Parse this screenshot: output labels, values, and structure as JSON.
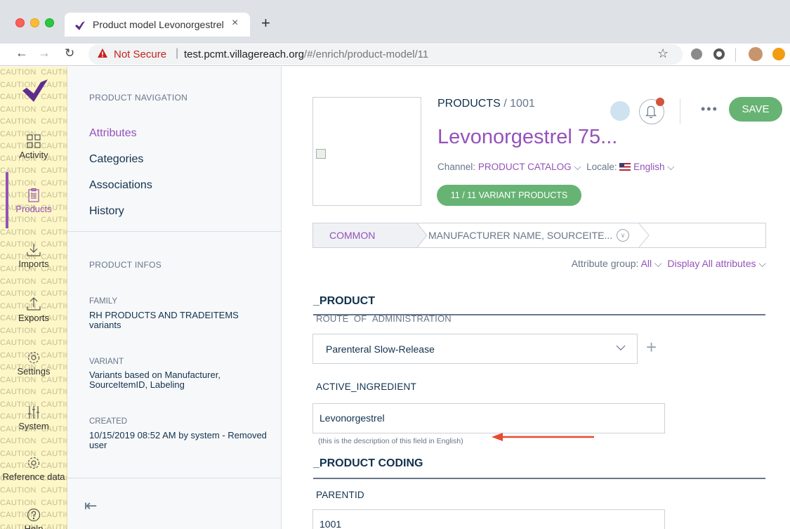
{
  "browser": {
    "tab_title": "Product model Levonorgestrel",
    "tab_close": "×",
    "new_tab": "+",
    "not_secure": "Not Secure",
    "url_host": "test.pcmt.villagereach.org",
    "url_path": "/#/enrich/product-model/11"
  },
  "rail": {
    "caution_text": "CAUTION  CAUTION",
    "items": [
      {
        "label": "Activity",
        "icon": "grid-icon"
      },
      {
        "label": "Products",
        "icon": "clipboard-icon"
      },
      {
        "label": "Imports",
        "icon": "import-icon"
      },
      {
        "label": "Exports",
        "icon": "export-icon"
      },
      {
        "label": "Settings",
        "icon": "gear-icon"
      },
      {
        "label": "System",
        "icon": "sliders-icon"
      },
      {
        "label": "Reference data",
        "icon": "gear-icon"
      },
      {
        "label": "Help",
        "icon": "help-icon"
      }
    ],
    "active_index": 1,
    "accent": "#9452ba"
  },
  "pnav": {
    "heading": "PRODUCT NAVIGATION",
    "links": [
      "Attributes",
      "Categories",
      "Associations",
      "History"
    ],
    "infos_heading": "PRODUCT INFOS",
    "family_label": "FAMILY",
    "family_value": "RH PRODUCTS AND TRADEITEMS variants",
    "variant_label": "VARIANT",
    "variant_value": "Variants based on Manufacturer, SourceItemID, Labeling",
    "created_label": "CREATED",
    "created_value": "10/15/2019 08:52 AM by system - Removed user"
  },
  "header": {
    "breadcrumb_section": "PRODUCTS",
    "breadcrumb_sep": "/",
    "breadcrumb_id": "1001",
    "title": "Levonorgestrel 75...",
    "channel_label": "Channel:",
    "channel_value": "PRODUCT CATALOG",
    "locale_label": "Locale:",
    "locale_value": "English",
    "variant_pill": "11 / 11 VARIANT PRODUCTS",
    "more": "•••",
    "save": "SAVE"
  },
  "steps": {
    "step1": "COMMON",
    "step2": "MANUFACTURER NAME, SOURCEITE..."
  },
  "filters": {
    "group_label": "Attribute group:",
    "group_value": "All",
    "display_value": "Display All attributes"
  },
  "form": {
    "group1_title": "_PRODUCT",
    "route_label": "ROUTE_OF_ADMINISTRATION",
    "route_value": "Parenteral Slow-Release",
    "plus": "+",
    "ingredient_label": "ACTIVE_INGREDIENT",
    "ingredient_value": "Levonorgestrel",
    "ingredient_desc": "(this is the description of this field in English)",
    "group2_title": "_PRODUCT CODING",
    "parentid_label": "PARENTID",
    "parentid_value": "1001"
  },
  "colors": {
    "accent": "#9452ba",
    "success": "#67b373",
    "annotation_arrow": "#e64b31"
  }
}
